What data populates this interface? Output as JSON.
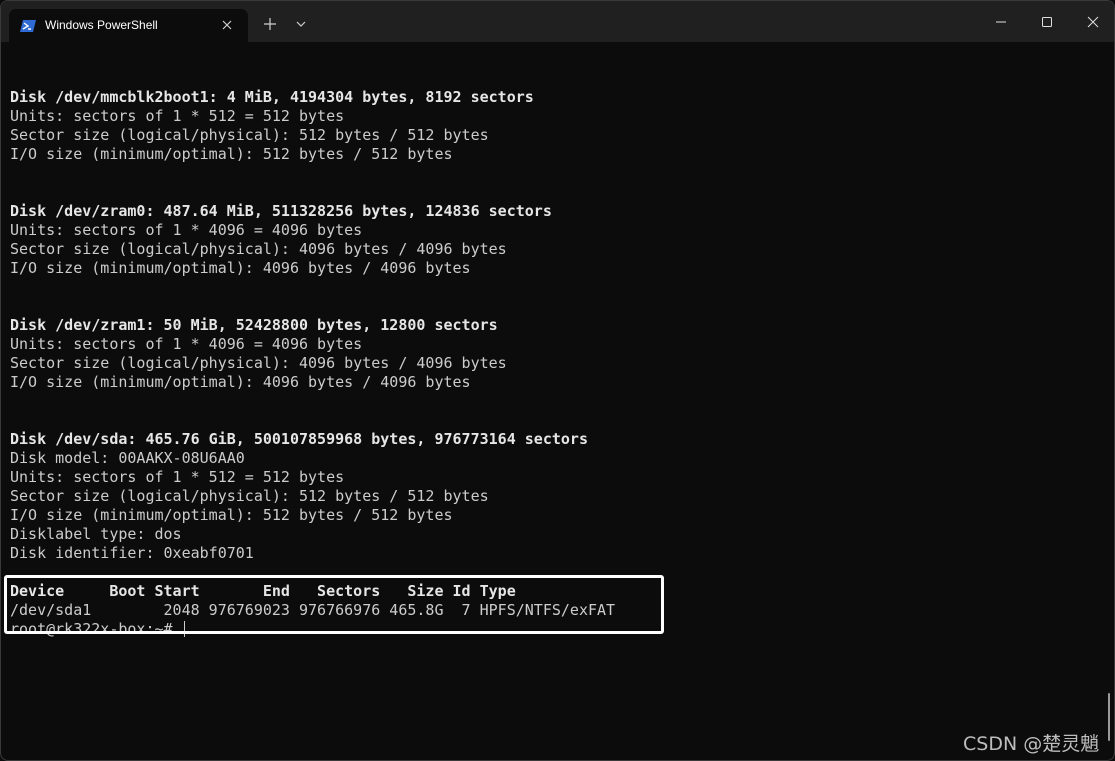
{
  "window": {
    "tab_title": "Windows PowerShell",
    "new_tab_label": "+"
  },
  "terminal": {
    "blocks": [
      {
        "header": "Disk /dev/mmcblk2boot1: 4 MiB, 4194304 bytes, 8192 sectors",
        "lines": [
          "Units: sectors of 1 * 512 = 512 bytes",
          "Sector size (logical/physical): 512 bytes / 512 bytes",
          "I/O size (minimum/optimal): 512 bytes / 512 bytes"
        ]
      },
      {
        "header": "Disk /dev/zram0: 487.64 MiB, 511328256 bytes, 124836 sectors",
        "lines": [
          "Units: sectors of 1 * 4096 = 4096 bytes",
          "Sector size (logical/physical): 4096 bytes / 4096 bytes",
          "I/O size (minimum/optimal): 4096 bytes / 4096 bytes"
        ]
      },
      {
        "header": "Disk /dev/zram1: 50 MiB, 52428800 bytes, 12800 sectors",
        "lines": [
          "Units: sectors of 1 * 4096 = 4096 bytes",
          "Sector size (logical/physical): 4096 bytes / 4096 bytes",
          "I/O size (minimum/optimal): 4096 bytes / 4096 bytes"
        ]
      },
      {
        "header": "Disk /dev/sda: 465.76 GiB, 500107859968 bytes, 976773164 sectors",
        "lines": [
          "Disk model: 00AAKX-08U6AA0",
          "Units: sectors of 1 * 512 = 512 bytes",
          "Sector size (logical/physical): 512 bytes / 512 bytes",
          "I/O size (minimum/optimal): 512 bytes / 512 bytes",
          "Disklabel type: dos",
          "Disk identifier: 0xeabf0701"
        ]
      }
    ],
    "partition_table": {
      "header": "Device     Boot Start       End   Sectors   Size Id Type",
      "rows": [
        "/dev/sda1        2048 976769023 976766976 465.8G  7 HPFS/NTFS/exFAT"
      ]
    },
    "prompt": "root@rk322x-box:~# "
  },
  "watermark": "CSDN @楚灵魈",
  "colors": {
    "background": "#0c0c0c",
    "titlebar": "#202020",
    "text": "#cccccc",
    "powershell_icon": "#2f6bd4"
  }
}
